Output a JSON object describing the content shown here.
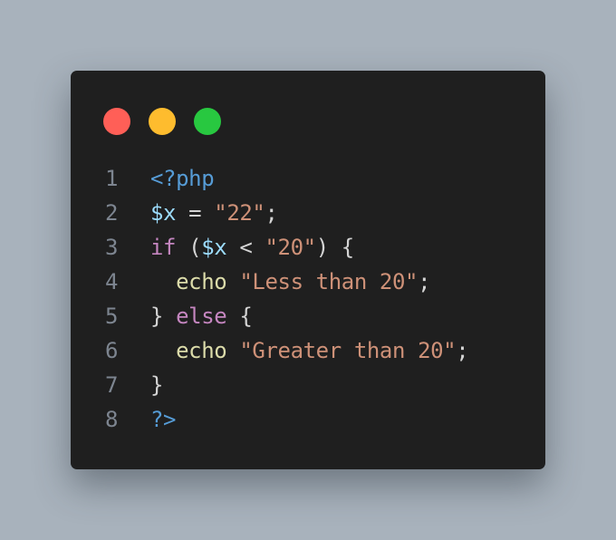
{
  "window": {
    "controls": [
      {
        "name": "close-dot",
        "color": "#ff5f57"
      },
      {
        "name": "minimize-dot",
        "color": "#febc2e"
      },
      {
        "name": "maximize-dot",
        "color": "#28c840"
      }
    ]
  },
  "colors": {
    "tag": "#569cd6",
    "variable": "#9cdcfe",
    "string": "#ce9178",
    "keyword": "#c586c0",
    "function": "#dcdcaa",
    "plain": "#d4d4d4"
  },
  "code": {
    "lines": [
      {
        "number": "1",
        "tokens": [
          {
            "text": "<?php",
            "kind": "tag"
          }
        ]
      },
      {
        "number": "2",
        "tokens": [
          {
            "text": "$x",
            "kind": "variable"
          },
          {
            "text": " = ",
            "kind": "plain"
          },
          {
            "text": "\"22\"",
            "kind": "string"
          },
          {
            "text": ";",
            "kind": "plain"
          }
        ]
      },
      {
        "number": "3",
        "tokens": [
          {
            "text": "if",
            "kind": "keyword"
          },
          {
            "text": " (",
            "kind": "plain"
          },
          {
            "text": "$x",
            "kind": "variable"
          },
          {
            "text": " < ",
            "kind": "plain"
          },
          {
            "text": "\"20\"",
            "kind": "string"
          },
          {
            "text": ") {",
            "kind": "plain"
          }
        ]
      },
      {
        "number": "4",
        "tokens": [
          {
            "text": "  ",
            "kind": "plain"
          },
          {
            "text": "echo",
            "kind": "function"
          },
          {
            "text": " ",
            "kind": "plain"
          },
          {
            "text": "\"Less than 20\"",
            "kind": "string"
          },
          {
            "text": ";",
            "kind": "plain"
          }
        ]
      },
      {
        "number": "5",
        "tokens": [
          {
            "text": "} ",
            "kind": "plain"
          },
          {
            "text": "else",
            "kind": "keyword"
          },
          {
            "text": " {",
            "kind": "plain"
          }
        ]
      },
      {
        "number": "6",
        "tokens": [
          {
            "text": "  ",
            "kind": "plain"
          },
          {
            "text": "echo",
            "kind": "function"
          },
          {
            "text": " ",
            "kind": "plain"
          },
          {
            "text": "\"Greater than 20\"",
            "kind": "string"
          },
          {
            "text": ";",
            "kind": "plain"
          }
        ]
      },
      {
        "number": "7",
        "tokens": [
          {
            "text": "}",
            "kind": "plain"
          }
        ]
      },
      {
        "number": "8",
        "tokens": [
          {
            "text": "?>",
            "kind": "tag"
          }
        ]
      }
    ]
  }
}
